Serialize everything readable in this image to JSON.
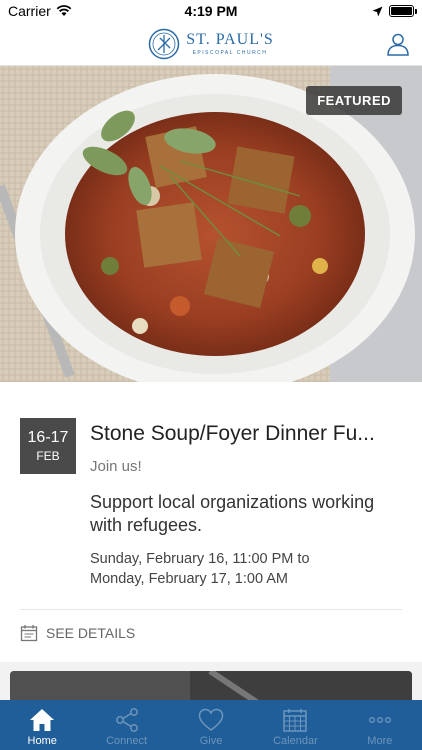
{
  "status_bar": {
    "carrier": "Carrier",
    "time": "4:19 PM"
  },
  "header": {
    "logo_title": "ST. PAUL'S",
    "logo_subtitle": "EPISCOPAL CHURCH"
  },
  "featured_card": {
    "badge": "FEATURED",
    "date_days": "16-17",
    "date_month": "FEB",
    "title": "Stone Soup/Foyer Dinner Fu...",
    "subtitle": "Join us!",
    "description": "Support local organizations working with refugees.",
    "when_line1": "Sunday, February 16, 11:00 PM to",
    "when_line2": "Monday, February 17, 1:00 AM",
    "details_label": "SEE DETAILS"
  },
  "tab_bar": {
    "tabs": [
      {
        "label": "Home",
        "icon": "home-icon",
        "active": true
      },
      {
        "label": "Connect",
        "icon": "share-icon",
        "active": false
      },
      {
        "label": "Give",
        "icon": "heart-icon",
        "active": false
      },
      {
        "label": "Calendar",
        "icon": "calendar-icon",
        "active": false
      },
      {
        "label": "More",
        "icon": "more-icon",
        "active": false
      }
    ]
  },
  "colors": {
    "brand_blue": "#2a6aa8",
    "tab_bar_bg": "#1f5e98",
    "date_block_bg": "#4a4a4a"
  }
}
